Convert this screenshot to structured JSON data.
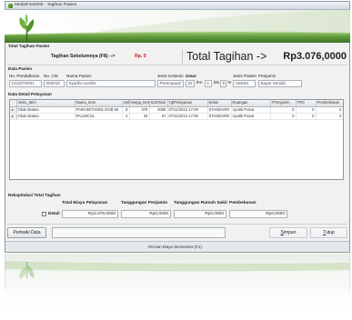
{
  "window": {
    "title": "MedisFos2000 - Tagihan Pasien",
    "title_icon": "app-icon",
    "logo_icon": "sprout-logo-icon"
  },
  "total_tagihan": {
    "section_label": "Total Tagihan Pasien",
    "sebelumnya_label": "Tagihan Sebelumnya (F8) -->",
    "sebelumnya_value": "Rp. 0",
    "total_label": "Total Tagihan ->",
    "total_value": "Rp3.076,0000"
  },
  "data_pasien": {
    "section_label": "Data Pasien",
    "no_pendaftaran": {
      "label": "No. Pendaftaran",
      "value": "1311070001"
    },
    "no_cm": {
      "label": "No. CM",
      "value": "000016"
    },
    "nama_pasien": {
      "label": "Nama Pasien",
      "value": "Syarifa Aurella"
    },
    "jenis_kelamin": {
      "label": "Jenis Kelamin",
      "value": "Perempuan"
    },
    "umur": {
      "label": "Umur",
      "tahun": "22",
      "tahun_unit": "thn",
      "bulan": "1",
      "bulan_unit": "bln",
      "hari": "9",
      "hari_unit": "hr"
    },
    "jenis_pasien": {
      "label": "Jenis Pasien",
      "value": "UMUM"
    },
    "penjamin": {
      "label": "Penjamin",
      "value": "Bayar Sendiri"
    }
  },
  "detail_pelayanan": {
    "section_label": "Data Detail Pelayanan",
    "row_indicator_icon": "row-indicator-icon",
    "columns": [
      "Jenis_Item",
      "Nama_Item",
      "Jml",
      "Harga_Item",
      "SubTotal",
      "TglPelayanan",
      "Kelas",
      "Ruangan",
      "TPenjamin",
      "TRS",
      "Pembebasan"
    ],
    "rows": [
      [
        "Obat-obatan",
        "PARASETAMOL DGB 50",
        "8",
        "376",
        "3009",
        "07/11/2012 17:09",
        "STANDARD",
        "Apotik Pusat",
        "0",
        "0",
        "0"
      ],
      [
        "Obat-obatan",
        "PALMICOL",
        "2",
        "34",
        "67",
        "07/11/2012 17:09",
        "STANDARD",
        "Apotik Pusat",
        "0",
        "0",
        "0"
      ]
    ]
  },
  "rekapitulasi": {
    "section_label": "Rekapitulasi Total Tagihan",
    "detail_label": "Detail",
    "detail_checked": false,
    "total_biaya": {
      "label": "Total Biaya Pelayanan",
      "value": "Rp3.076,0000"
    },
    "tanggungan_penjamin": {
      "label": "Tanggungan Penjamin",
      "value": "Rp0,0000"
    },
    "tanggungan_rs": {
      "label": "Tanggungan Rumah Sakit",
      "value": "Rp0,0000"
    },
    "pembebasan": {
      "label": "Pembebasan",
      "value": "Rp0,0000"
    }
  },
  "footer": {
    "perbaiki_label": "Perbaiki Data",
    "simpan_label": "Simpan",
    "tutup_label": "Tutup"
  },
  "status_bar": {
    "text": "Rincian Biaya Sementara (F1)"
  },
  "colors": {
    "header_green": "#4f8a31",
    "leaf_green": "#6fb33b",
    "previous_bill_red": "#d21a1a",
    "window_bg": "#f0f1f0"
  }
}
